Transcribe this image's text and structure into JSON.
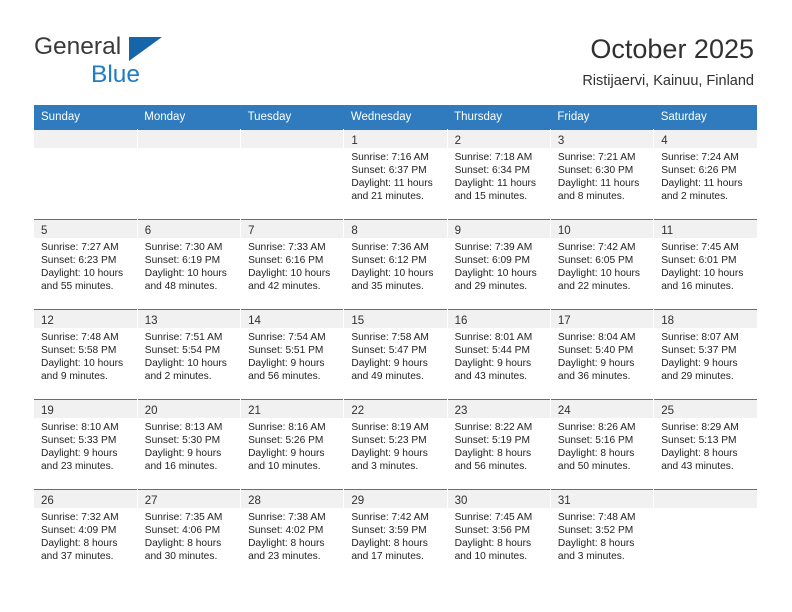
{
  "header": {
    "logo": {
      "word1": "General",
      "word2": "Blue",
      "triangle_icon": "blue-triangle-icon",
      "color1": "#3a3a3a",
      "color2": "#1f7dc4"
    },
    "title": "October 2025",
    "subtitle": "Ristijaervi, Kainuu, Finland"
  },
  "theme": {
    "header_bg": "#2f7bbd",
    "daynum_bg": "#f1f1f1",
    "row_border": "#2f7bbd",
    "text": "#232323"
  },
  "calendar": {
    "weekday_headers": [
      "Sunday",
      "Monday",
      "Tuesday",
      "Wednesday",
      "Thursday",
      "Friday",
      "Saturday"
    ],
    "weeks": [
      [
        {
          "day": ""
        },
        {
          "day": ""
        },
        {
          "day": ""
        },
        {
          "day": "1",
          "sunrise": "Sunrise: 7:16 AM",
          "sunset": "Sunset: 6:37 PM",
          "daylight1": "Daylight: 11 hours",
          "daylight2": "and 21 minutes."
        },
        {
          "day": "2",
          "sunrise": "Sunrise: 7:18 AM",
          "sunset": "Sunset: 6:34 PM",
          "daylight1": "Daylight: 11 hours",
          "daylight2": "and 15 minutes."
        },
        {
          "day": "3",
          "sunrise": "Sunrise: 7:21 AM",
          "sunset": "Sunset: 6:30 PM",
          "daylight1": "Daylight: 11 hours",
          "daylight2": "and 8 minutes."
        },
        {
          "day": "4",
          "sunrise": "Sunrise: 7:24 AM",
          "sunset": "Sunset: 6:26 PM",
          "daylight1": "Daylight: 11 hours",
          "daylight2": "and 2 minutes."
        }
      ],
      [
        {
          "day": "5",
          "sunrise": "Sunrise: 7:27 AM",
          "sunset": "Sunset: 6:23 PM",
          "daylight1": "Daylight: 10 hours",
          "daylight2": "and 55 minutes."
        },
        {
          "day": "6",
          "sunrise": "Sunrise: 7:30 AM",
          "sunset": "Sunset: 6:19 PM",
          "daylight1": "Daylight: 10 hours",
          "daylight2": "and 48 minutes."
        },
        {
          "day": "7",
          "sunrise": "Sunrise: 7:33 AM",
          "sunset": "Sunset: 6:16 PM",
          "daylight1": "Daylight: 10 hours",
          "daylight2": "and 42 minutes."
        },
        {
          "day": "8",
          "sunrise": "Sunrise: 7:36 AM",
          "sunset": "Sunset: 6:12 PM",
          "daylight1": "Daylight: 10 hours",
          "daylight2": "and 35 minutes."
        },
        {
          "day": "9",
          "sunrise": "Sunrise: 7:39 AM",
          "sunset": "Sunset: 6:09 PM",
          "daylight1": "Daylight: 10 hours",
          "daylight2": "and 29 minutes."
        },
        {
          "day": "10",
          "sunrise": "Sunrise: 7:42 AM",
          "sunset": "Sunset: 6:05 PM",
          "daylight1": "Daylight: 10 hours",
          "daylight2": "and 22 minutes."
        },
        {
          "day": "11",
          "sunrise": "Sunrise: 7:45 AM",
          "sunset": "Sunset: 6:01 PM",
          "daylight1": "Daylight: 10 hours",
          "daylight2": "and 16 minutes."
        }
      ],
      [
        {
          "day": "12",
          "sunrise": "Sunrise: 7:48 AM",
          "sunset": "Sunset: 5:58 PM",
          "daylight1": "Daylight: 10 hours",
          "daylight2": "and 9 minutes."
        },
        {
          "day": "13",
          "sunrise": "Sunrise: 7:51 AM",
          "sunset": "Sunset: 5:54 PM",
          "daylight1": "Daylight: 10 hours",
          "daylight2": "and 2 minutes."
        },
        {
          "day": "14",
          "sunrise": "Sunrise: 7:54 AM",
          "sunset": "Sunset: 5:51 PM",
          "daylight1": "Daylight: 9 hours",
          "daylight2": "and 56 minutes."
        },
        {
          "day": "15",
          "sunrise": "Sunrise: 7:58 AM",
          "sunset": "Sunset: 5:47 PM",
          "daylight1": "Daylight: 9 hours",
          "daylight2": "and 49 minutes."
        },
        {
          "day": "16",
          "sunrise": "Sunrise: 8:01 AM",
          "sunset": "Sunset: 5:44 PM",
          "daylight1": "Daylight: 9 hours",
          "daylight2": "and 43 minutes."
        },
        {
          "day": "17",
          "sunrise": "Sunrise: 8:04 AM",
          "sunset": "Sunset: 5:40 PM",
          "daylight1": "Daylight: 9 hours",
          "daylight2": "and 36 minutes."
        },
        {
          "day": "18",
          "sunrise": "Sunrise: 8:07 AM",
          "sunset": "Sunset: 5:37 PM",
          "daylight1": "Daylight: 9 hours",
          "daylight2": "and 29 minutes."
        }
      ],
      [
        {
          "day": "19",
          "sunrise": "Sunrise: 8:10 AM",
          "sunset": "Sunset: 5:33 PM",
          "daylight1": "Daylight: 9 hours",
          "daylight2": "and 23 minutes."
        },
        {
          "day": "20",
          "sunrise": "Sunrise: 8:13 AM",
          "sunset": "Sunset: 5:30 PM",
          "daylight1": "Daylight: 9 hours",
          "daylight2": "and 16 minutes."
        },
        {
          "day": "21",
          "sunrise": "Sunrise: 8:16 AM",
          "sunset": "Sunset: 5:26 PM",
          "daylight1": "Daylight: 9 hours",
          "daylight2": "and 10 minutes."
        },
        {
          "day": "22",
          "sunrise": "Sunrise: 8:19 AM",
          "sunset": "Sunset: 5:23 PM",
          "daylight1": "Daylight: 9 hours",
          "daylight2": "and 3 minutes."
        },
        {
          "day": "23",
          "sunrise": "Sunrise: 8:22 AM",
          "sunset": "Sunset: 5:19 PM",
          "daylight1": "Daylight: 8 hours",
          "daylight2": "and 56 minutes."
        },
        {
          "day": "24",
          "sunrise": "Sunrise: 8:26 AM",
          "sunset": "Sunset: 5:16 PM",
          "daylight1": "Daylight: 8 hours",
          "daylight2": "and 50 minutes."
        },
        {
          "day": "25",
          "sunrise": "Sunrise: 8:29 AM",
          "sunset": "Sunset: 5:13 PM",
          "daylight1": "Daylight: 8 hours",
          "daylight2": "and 43 minutes."
        }
      ],
      [
        {
          "day": "26",
          "sunrise": "Sunrise: 7:32 AM",
          "sunset": "Sunset: 4:09 PM",
          "daylight1": "Daylight: 8 hours",
          "daylight2": "and 37 minutes."
        },
        {
          "day": "27",
          "sunrise": "Sunrise: 7:35 AM",
          "sunset": "Sunset: 4:06 PM",
          "daylight1": "Daylight: 8 hours",
          "daylight2": "and 30 minutes."
        },
        {
          "day": "28",
          "sunrise": "Sunrise: 7:38 AM",
          "sunset": "Sunset: 4:02 PM",
          "daylight1": "Daylight: 8 hours",
          "daylight2": "and 23 minutes."
        },
        {
          "day": "29",
          "sunrise": "Sunrise: 7:42 AM",
          "sunset": "Sunset: 3:59 PM",
          "daylight1": "Daylight: 8 hours",
          "daylight2": "and 17 minutes."
        },
        {
          "day": "30",
          "sunrise": "Sunrise: 7:45 AM",
          "sunset": "Sunset: 3:56 PM",
          "daylight1": "Daylight: 8 hours",
          "daylight2": "and 10 minutes."
        },
        {
          "day": "31",
          "sunrise": "Sunrise: 7:48 AM",
          "sunset": "Sunset: 3:52 PM",
          "daylight1": "Daylight: 8 hours",
          "daylight2": "and 3 minutes."
        },
        {
          "day": ""
        }
      ]
    ]
  }
}
